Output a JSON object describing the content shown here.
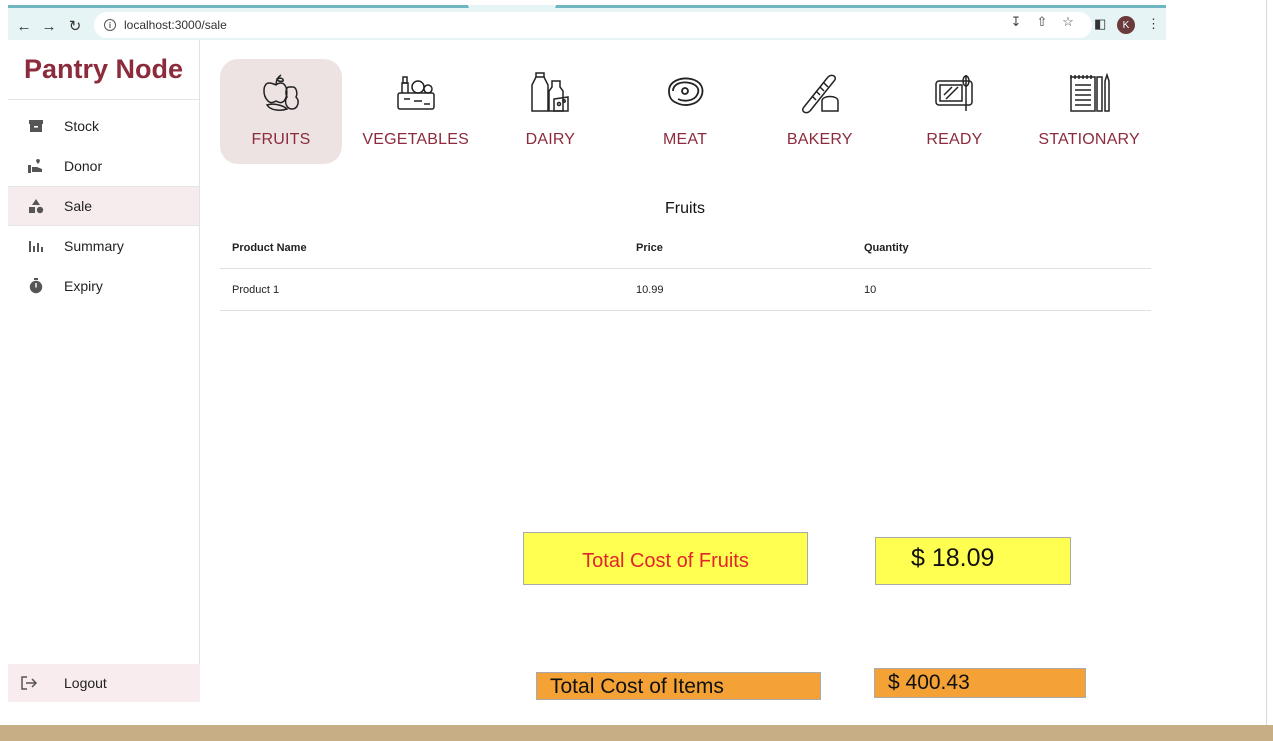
{
  "browser": {
    "url": "localhost:3000/sale",
    "profile_initial": "K"
  },
  "brand": "Pantry Node",
  "sidebar": {
    "items": [
      {
        "label": "Stock",
        "icon": "archive-icon"
      },
      {
        "label": "Donor",
        "icon": "donate-hand-icon"
      },
      {
        "label": "Sale",
        "icon": "shapes-icon",
        "active": true
      },
      {
        "label": "Summary",
        "icon": "bar-chart-icon"
      },
      {
        "label": "Expiry",
        "icon": "timer-icon"
      }
    ],
    "logout_label": "Logout"
  },
  "categories": [
    {
      "label": "FRUITS",
      "icon": "fruits-icon",
      "active": true
    },
    {
      "label": "VEGETABLES",
      "icon": "vegetables-icon"
    },
    {
      "label": "DAIRY",
      "icon": "dairy-icon"
    },
    {
      "label": "MEAT",
      "icon": "meat-icon"
    },
    {
      "label": "BAKERY",
      "icon": "bakery-icon"
    },
    {
      "label": "READY",
      "icon": "ready-meal-icon"
    },
    {
      "label": "STATIONARY",
      "icon": "stationary-icon"
    }
  ],
  "section_title": "Fruits",
  "table": {
    "headers": [
      "Product Name",
      "Price",
      "Quantity"
    ],
    "rows": [
      [
        "Product 1",
        "10.99",
        "10"
      ]
    ]
  },
  "totals": {
    "category_label": "Total Cost of Fruits",
    "category_value": "$ 18.09",
    "items_label": "Total Cost of Items",
    "items_value": "$ 400.43"
  },
  "colors": {
    "brand": "#8c2b3b",
    "category_total_bg": "#ffff52",
    "items_total_bg": "#f4a236",
    "footer": "#c8ae84"
  }
}
